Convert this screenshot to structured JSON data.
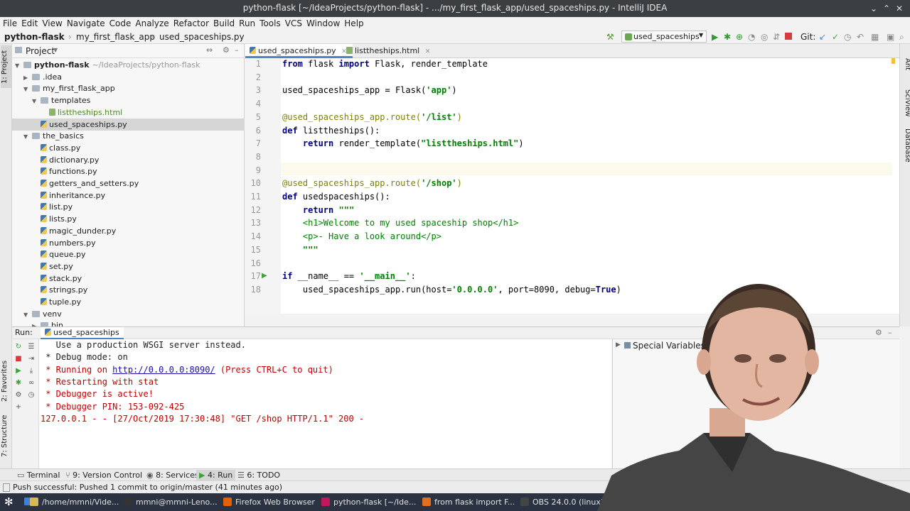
{
  "window": {
    "title": "python-flask [~/IdeaProjects/python-flask] - .../my_first_flask_app/used_spaceships.py - IntelliJ IDEA",
    "controls": [
      "⌄",
      "⌃",
      "✕"
    ]
  },
  "menu": [
    "File",
    "Edit",
    "View",
    "Navigate",
    "Code",
    "Analyze",
    "Refactor",
    "Build",
    "Run",
    "Tools",
    "VCS",
    "Window",
    "Help"
  ],
  "navbar": {
    "breadcrumbs": [
      "python-flask",
      "my_first_flask_app",
      "used_spaceships.py"
    ],
    "run_config": "used_spaceships",
    "git_label": "Git:"
  },
  "left_strip": {
    "project_tab": "1: Project",
    "favorites_tab": "2: Favorites",
    "structure_tab": "7: Structure"
  },
  "right_strip": [
    "Ant",
    "SciView",
    "Database"
  ],
  "project": {
    "header": "Project",
    "tree": [
      {
        "label": "python-flask",
        "suffix": "~/IdeaProjects/python-flask",
        "kind": "folder",
        "level": 0,
        "open": true
      },
      {
        "label": ".idea",
        "kind": "folder",
        "level": 1,
        "open": false
      },
      {
        "label": "my_first_flask_app",
        "kind": "folder",
        "level": 1,
        "open": true
      },
      {
        "label": "templates",
        "kind": "folder",
        "level": 2,
        "open": true
      },
      {
        "label": "listtheships.html",
        "kind": "html",
        "level": 3
      },
      {
        "label": "used_spaceships.py",
        "kind": "py",
        "level": 2,
        "selected": true
      },
      {
        "label": "the_basics",
        "kind": "folder",
        "level": 1,
        "open": true
      },
      {
        "label": "class.py",
        "kind": "py",
        "level": 2
      },
      {
        "label": "dictionary.py",
        "kind": "py",
        "level": 2
      },
      {
        "label": "functions.py",
        "kind": "py",
        "level": 2
      },
      {
        "label": "getters_and_setters.py",
        "kind": "py",
        "level": 2
      },
      {
        "label": "inheritance.py",
        "kind": "py",
        "level": 2
      },
      {
        "label": "list.py",
        "kind": "py",
        "level": 2
      },
      {
        "label": "lists.py",
        "kind": "py",
        "level": 2
      },
      {
        "label": "magic_dunder.py",
        "kind": "py",
        "level": 2
      },
      {
        "label": "numbers.py",
        "kind": "py",
        "level": 2
      },
      {
        "label": "queue.py",
        "kind": "py",
        "level": 2
      },
      {
        "label": "set.py",
        "kind": "py",
        "level": 2
      },
      {
        "label": "stack.py",
        "kind": "py",
        "level": 2
      },
      {
        "label": "strings.py",
        "kind": "py",
        "level": 2
      },
      {
        "label": "tuple.py",
        "kind": "py",
        "level": 2
      },
      {
        "label": "venv",
        "kind": "folder",
        "level": 1,
        "open": true
      },
      {
        "label": "bin",
        "kind": "folder",
        "level": 2,
        "open": false
      }
    ]
  },
  "editor": {
    "tabs": [
      {
        "label": "used_spaceships.py",
        "active": true
      },
      {
        "label": "listtheships.html",
        "active": false
      }
    ],
    "lines": [
      {
        "n": "1",
        "html": "<span class='kw'>from</span> flask <span class='kw'>import</span> Flask, render_template"
      },
      {
        "n": "2",
        "html": ""
      },
      {
        "n": "3",
        "html": "used_spaceships_app = Flask(<span class='st'>'app'</span>)"
      },
      {
        "n": "4",
        "html": ""
      },
      {
        "n": "5",
        "html": "<span class='dec'>@used_spaceships_app.route(</span><span class='st'>'/list'</span><span class='dec'>)</span>"
      },
      {
        "n": "6",
        "html": "<span class='kw'>def</span> listtheships():"
      },
      {
        "n": "7",
        "html": "    <span class='kw'>return</span> render_template(<span class='st'>\"listtheships.html\"</span>)"
      },
      {
        "n": "8",
        "html": ""
      },
      {
        "n": "9",
        "html": ""
      },
      {
        "n": "10",
        "html": "<span class='dec'>@used_spaceships_app.route(</span><span class='st'>'/shop'</span><span class='dec'>)</span>"
      },
      {
        "n": "11",
        "html": "<span class='kw'>def</span> usedspaceships():"
      },
      {
        "n": "12",
        "html": "    <span class='kw'>return</span> <span class='st'>\"\"\"</span>"
      },
      {
        "n": "13",
        "html": "    <span class='tag'>&lt;h1&gt;Welcome to my used spaceship shop&lt;/h1&gt;</span>"
      },
      {
        "n": "14",
        "html": "    <span class='tag'>&lt;p&gt;- Have a look around&lt;/p&gt;</span>"
      },
      {
        "n": "15",
        "html": "    <span class='st'>\"\"\"</span>"
      },
      {
        "n": "16",
        "html": ""
      },
      {
        "n": "17",
        "html": "<span class='kw'>if</span> __name__ == <span class='st'>'__main__'</span>:"
      },
      {
        "n": "18",
        "html": "    used_spaceships_app.run(host=<span class='st'>'0.0.0.0'</span>, port=8090, debug=<span class='kw'>True</span>)"
      }
    ]
  },
  "run": {
    "label": "Run:",
    "config": "used_spaceships",
    "console": [
      {
        "text": "   Use a production WSGI server instead.",
        "cls": ""
      },
      {
        "text": " * Debug mode: on",
        "cls": ""
      },
      {
        "text": " * Running on ",
        "link": "http://0.0.0.0:8090/",
        "after": " (Press CTRL+C to quit)",
        "cls": "red"
      },
      {
        "text": " * Restarting with stat",
        "cls": "red"
      },
      {
        "text": " * Debugger is active!",
        "cls": "red"
      },
      {
        "text": " * Debugger PIN: 153-092-425",
        "cls": "red"
      },
      {
        "text": "127.0.0.1 - - [27/Oct/2019 17:30:48] \"GET /shop HTTP/1.1\" 200 -",
        "cls": "red"
      }
    ],
    "special_variables": "Special Variables"
  },
  "tool_tabs": [
    "Terminal",
    "9: Version Control",
    "8: Services",
    "4: Run",
    "6: TODO"
  ],
  "status": "Push successful: Pushed 1 commit to origin/master (41 minutes ago)",
  "taskbar": [
    {
      "label": "/home/mmni/Vide...",
      "color": "#d7b85a"
    },
    {
      "label": "mmni@mmni-Leno...",
      "color": "#333333"
    },
    {
      "label": "Firefox Web Browser",
      "color": "#e66000"
    },
    {
      "label": "python-flask [~/Ide...",
      "color": "#c2185b"
    },
    {
      "label": "from flask import F...",
      "color": "#e07020"
    },
    {
      "label": "OBS 24.0.0 (linux)",
      "color": "#444444"
    }
  ]
}
